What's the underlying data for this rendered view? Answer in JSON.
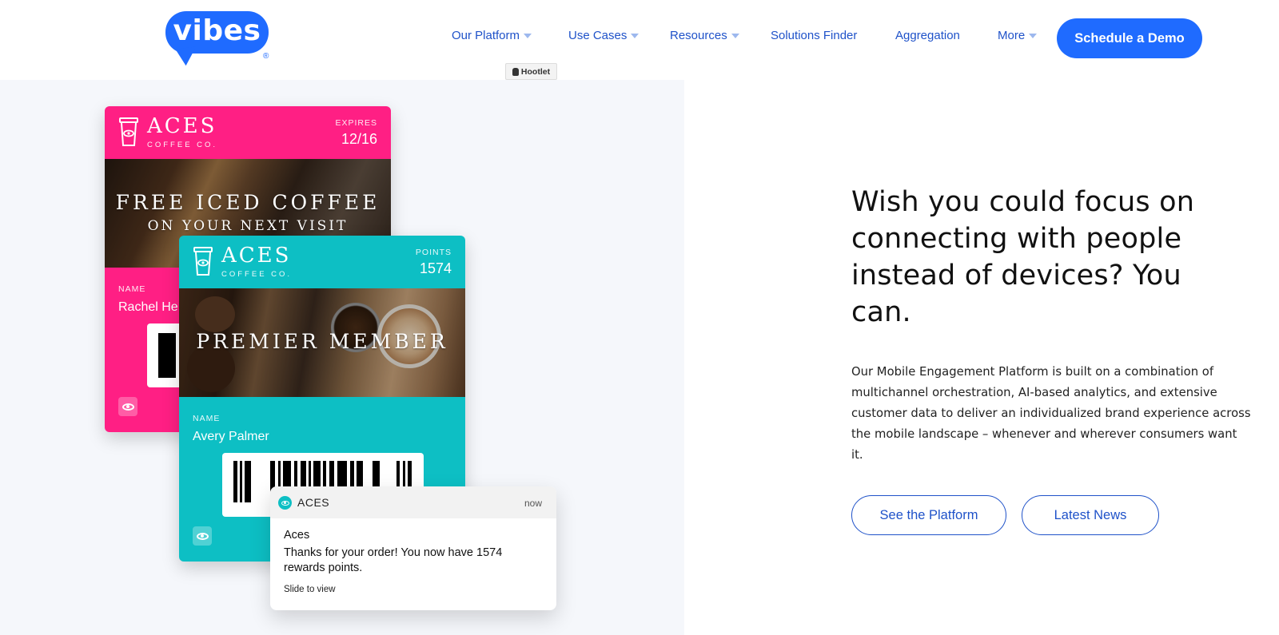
{
  "logo": {
    "text": "vibes",
    "registered": "®"
  },
  "nav": {
    "items": [
      {
        "label": "Our Platform",
        "has_dropdown": true
      },
      {
        "label": "Use Cases",
        "has_dropdown": true
      },
      {
        "label": "Resources",
        "has_dropdown": true
      },
      {
        "label": "Solutions Finder",
        "has_dropdown": false
      },
      {
        "label": "Aggregation",
        "has_dropdown": false
      },
      {
        "label": "More",
        "has_dropdown": true
      }
    ],
    "cta_label": "Schedule a Demo"
  },
  "hootlet": {
    "label": "Hootlet"
  },
  "cards": {
    "pink": {
      "brand": "ACES",
      "brand_sub": "COFFEE CO.",
      "meta_label": "EXPIRES",
      "meta_value": "12/16",
      "title_line1": "FREE ICED COFFEE",
      "title_line2": "ON YOUR NEXT VISIT",
      "name_label": "NAME",
      "name_value": "Rachel He"
    },
    "teal": {
      "brand": "ACES",
      "brand_sub": "COFFEE CO.",
      "meta_label": "POINTS",
      "meta_value": "1574",
      "title": "PREMIER MEMBER",
      "name_label": "NAME",
      "name_value": "Avery Palmer"
    }
  },
  "notification": {
    "app": "ACES",
    "time": "now",
    "title": "Aces",
    "body": "Thanks for your order! You now have 1574 rewards points.",
    "footer": "Slide to view"
  },
  "hero": {
    "headline": "Wish you could focus on connecting with people instead of devices? You can.",
    "body": "Our Mobile Engagement Platform is built on a combination of multichannel orchestration, AI-based analytics, and extensive customer data to deliver an individualized brand experience across the mobile landscape – whenever and wherever consumers want it.",
    "primary_button": "See the Platform",
    "secondary_button": "Latest News"
  },
  "colors": {
    "brand_blue": "#1f6bff",
    "nav_blue": "#1f52c9",
    "card_pink": "#ff1f84",
    "card_teal": "#0dbfc4"
  }
}
